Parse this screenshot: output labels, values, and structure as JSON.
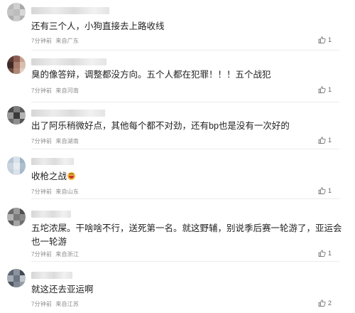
{
  "comments": [
    {
      "text": "还有三个人，小狗直接去上路收线",
      "time": "7分钟前",
      "location": "来自广东",
      "likes": "1",
      "avatar_colors": [
        "#b9b9b9",
        "#d0d0d0",
        "#a9a9a9",
        "#c4c4c4",
        "#bdbdbd",
        "#d8d8d8",
        "#aeaeae",
        "#cacaca",
        "#b2b2b2"
      ]
    },
    {
      "text": "臭的像答辩，调整都没方向。五个人都在犯罪！！！五个战犯",
      "time": "7分钟前",
      "location": "来自河南",
      "likes": "1",
      "avatar_colors": [
        "#5a3a32",
        "#8b5e54",
        "#c9a28f",
        "#3f2a28",
        "#a87b6b",
        "#d9bfb0",
        "#6e4a40",
        "#b08878",
        "#e2cfc3"
      ]
    },
    {
      "text": "出了阿乐稍微好点，其他每个都不对劲，还有bp也是没有一次好的",
      "time": "7分钟前",
      "location": "来自湖南",
      "likes": "1",
      "avatar_colors": [
        "#4a4a4a",
        "#7d7d7d",
        "#5d5d5d",
        "#9a9a9a",
        "#3a3a3a",
        "#b5b5b5",
        "#6c6c6c",
        "#8f8f8f",
        "#555555"
      ]
    },
    {
      "text": "收枪之战",
      "has_emoji": true,
      "time": "7分钟前",
      "location": "来自山东",
      "likes": "1",
      "avatar_colors": [
        "#b8c6d4",
        "#d9e2ea",
        "#9fb3c5",
        "#c9d4de",
        "#e6ecf1",
        "#aebfcd",
        "#c2cfda",
        "#dbe3ea",
        "#a7b9c8"
      ]
    },
    {
      "text": "五坨浓屎。干啥啥不行，送死第一名。就这野辅，别说季后赛一轮游了，亚运会也一轮游",
      "time": "7分钟前",
      "location": "来自浙江",
      "likes": "1",
      "avatar_colors": [
        "#6a6a6a",
        "#9b9b9b",
        "#4f4f4f",
        "#b3b3b3",
        "#7a7a7a",
        "#8a8a8a",
        "#5f5f5f",
        "#a5a5a5",
        "#707070"
      ]
    },
    {
      "text": "就这还去亚运啊",
      "time": "7分钟前",
      "location": "来自江苏",
      "likes": "2",
      "avatar_colors": [
        "#5b6470",
        "#8a939e",
        "#3f4752",
        "#a4acb6",
        "#6d7681",
        "#c0c6cd",
        "#4c5560",
        "#7f8893",
        "#959da7"
      ]
    }
  ]
}
